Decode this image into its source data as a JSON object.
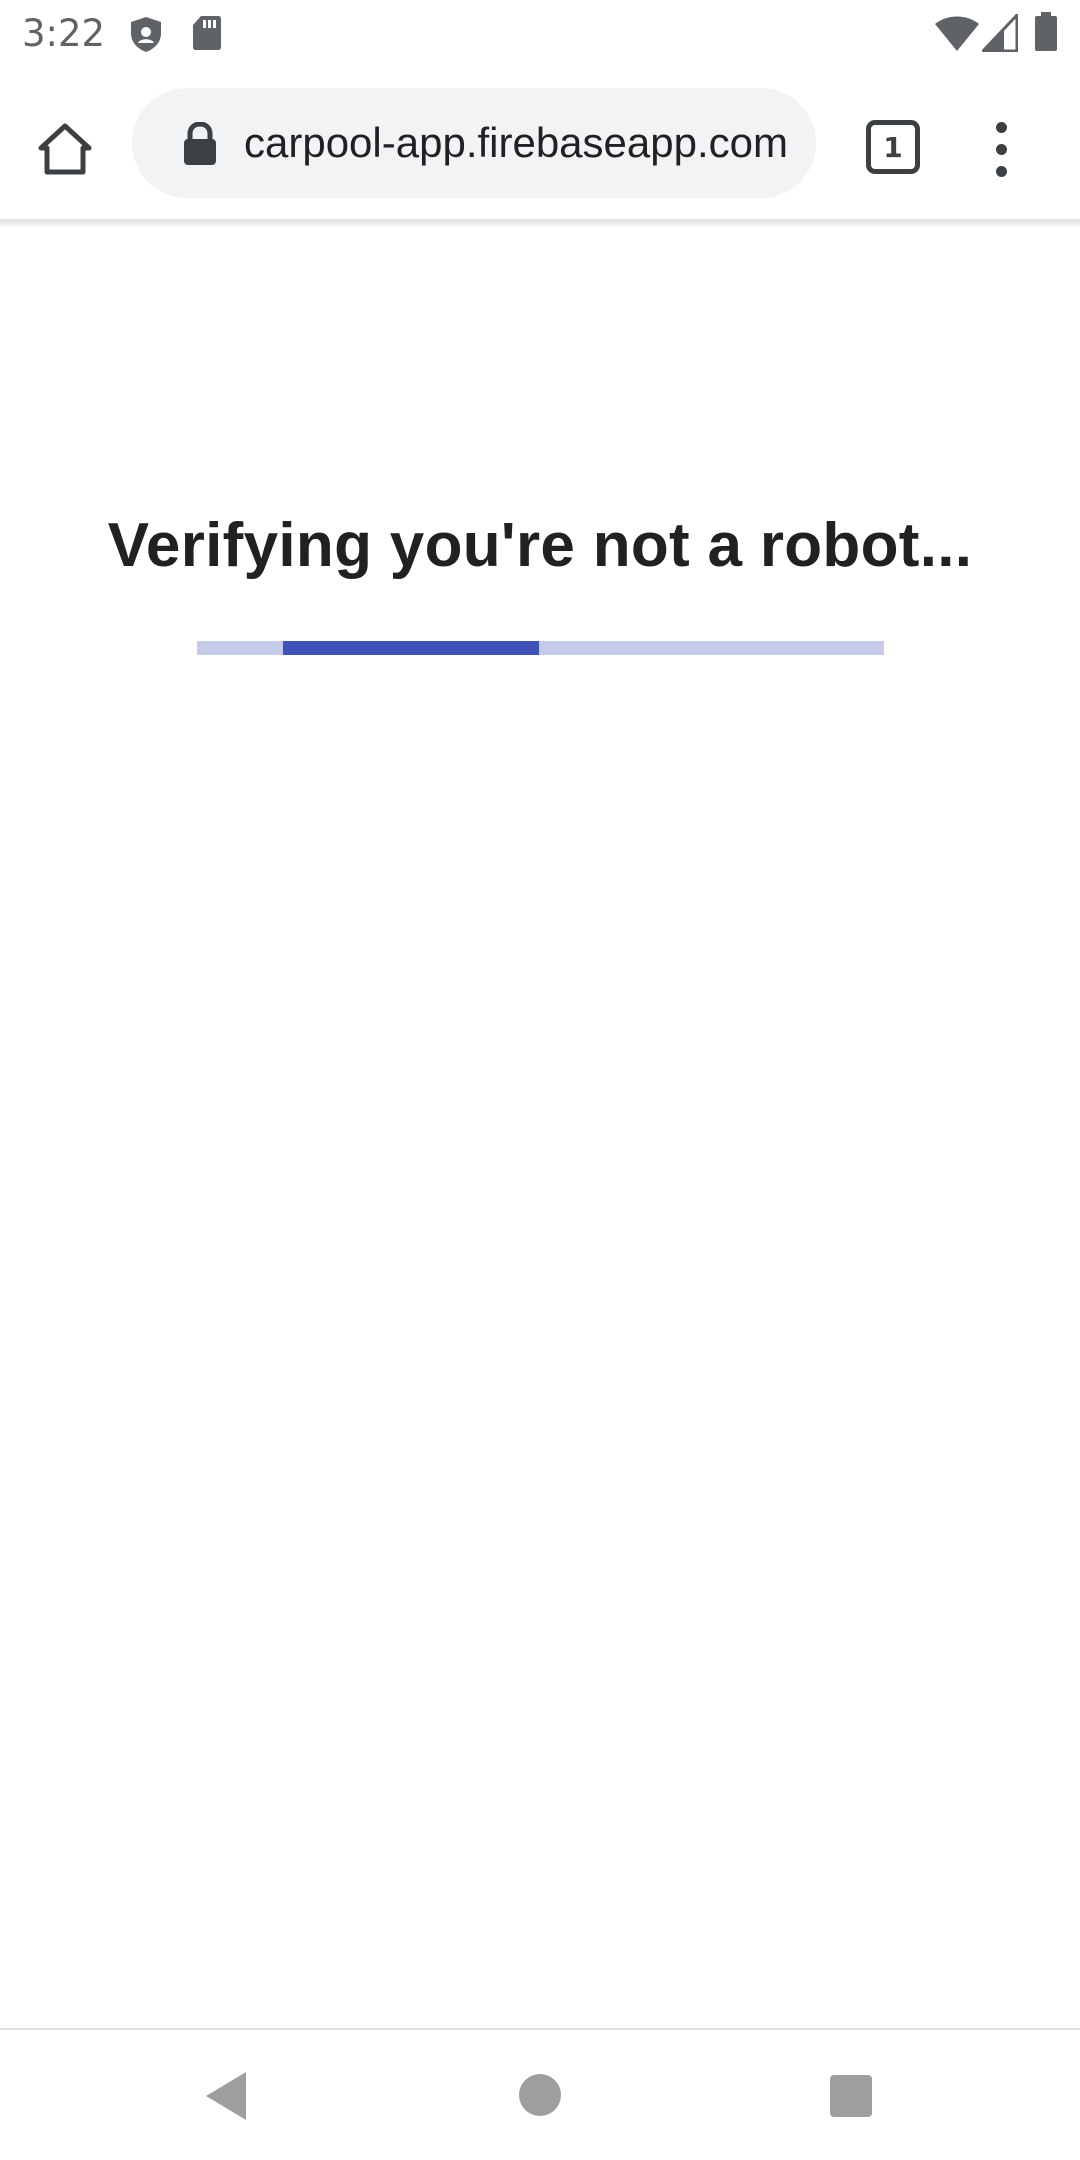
{
  "status_bar": {
    "time": "3:22",
    "left_icons": [
      "shield-icon",
      "sd-card-icon"
    ],
    "right_icons": [
      "wifi-icon",
      "cellular-signal-icon",
      "battery-icon"
    ]
  },
  "browser": {
    "url": "carpool-app.firebaseapp.com",
    "tab_count": "1",
    "icons": [
      "home-icon",
      "lock-icon",
      "tab-switcher-icon",
      "more-vert-icon"
    ]
  },
  "page": {
    "title": "Verifying you're not a robot...",
    "progress": {
      "type": "indeterminate",
      "colors": {
        "track": "#c5cae9",
        "bar": "#3f51b5"
      }
    }
  },
  "navigation": {
    "icons": [
      "back-icon",
      "home-circle-icon",
      "recents-icon"
    ]
  }
}
